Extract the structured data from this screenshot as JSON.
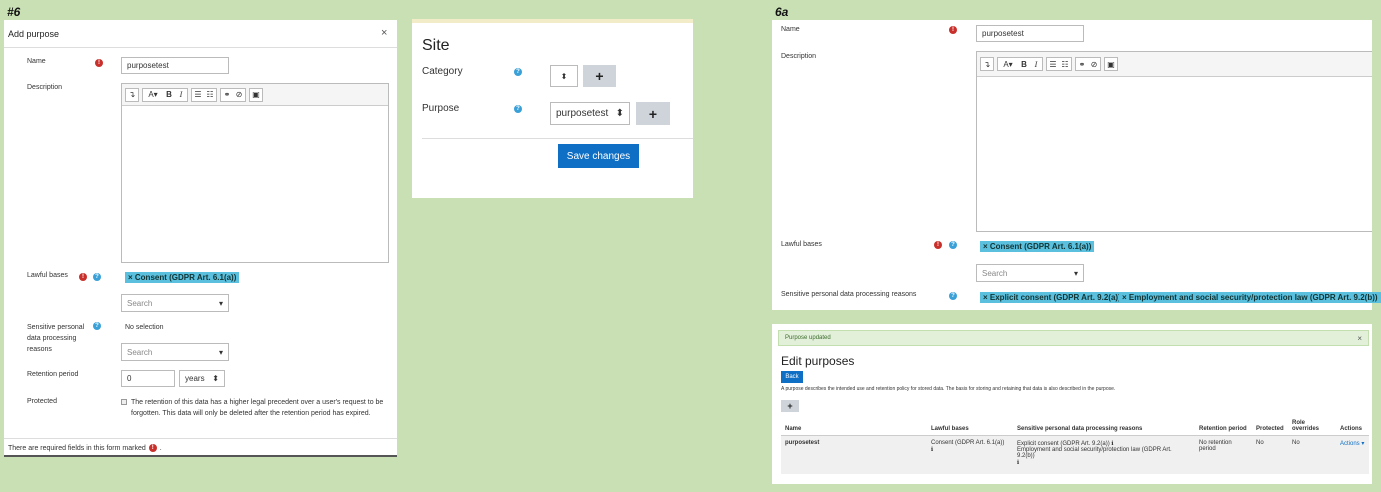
{
  "steps": {
    "left": "#6",
    "right": "6a"
  },
  "left_dialog": {
    "title": "Add purpose",
    "close": "×",
    "name_label": "Name",
    "name_value": "purposetest",
    "description_label": "Description",
    "lawful_label": "Lawful bases",
    "lawful_tag": "× Consent (GDPR Art. 6.1(a))",
    "lawful_search": "Search",
    "sensitive_label": "Sensitive personal data processing reasons",
    "sensitive_value": "No selection",
    "sensitive_search": "Search",
    "retention_label": "Retention period",
    "retention_value": "0",
    "retention_unit": "years",
    "protected_label": "Protected",
    "protected_text": "The retention of this data has a higher legal precedent over a user's request to be forgotten. This data will only be deleted after the retention period has expired.",
    "footer_text": "There are required fields in this form marked"
  },
  "site_panel": {
    "heading": "Site",
    "category_label": "Category",
    "purpose_label": "Purpose",
    "purpose_value": "purposetest",
    "plus": "+",
    "save": "Save changes"
  },
  "right_form": {
    "name_label": "Name",
    "name_value": "purposetest",
    "description_label": "Description",
    "lawful_label": "Lawful bases",
    "lawful_tag": "× Consent (GDPR Art. 6.1(a))",
    "search": "Search",
    "sensitive_label": "Sensitive personal data processing reasons",
    "sensitive_tag1": "× Explicit consent (GDPR Art. 9.2(a))",
    "sensitive_tag2": "× Employment and social security/protection law (GDPR Art. 9.2(b))"
  },
  "edit_purposes": {
    "alert": "Purpose updated",
    "alert_close": "×",
    "title": "Edit purposes",
    "back": "Back",
    "description": "A purpose describes the intended use and retention policy for stored data. The basis for storing and retaining that data is also described in the purpose.",
    "plus": "+",
    "headers": [
      "Name",
      "Lawful bases",
      "Sensitive personal data processing reasons",
      "Retention period",
      "Protected",
      "Role overrides",
      "Actions"
    ],
    "row": {
      "name": "purposetest",
      "lawful": "Consent (GDPR Art. 6.1(a))",
      "sensitive1": "Explicit consent (GDPR Art. 9.2(a))",
      "sensitive2": "Employment and social security/protection law (GDPR Art. 9.2(b))",
      "retention": "No retention period",
      "protected": "No",
      "overrides": "No",
      "actions": "Actions"
    }
  },
  "colors": {
    "background": "#c8e0b4",
    "tag": "#5bc0de",
    "primary": "#0f6fc5",
    "required": "#c9302c",
    "help": "#3aa0d8"
  }
}
